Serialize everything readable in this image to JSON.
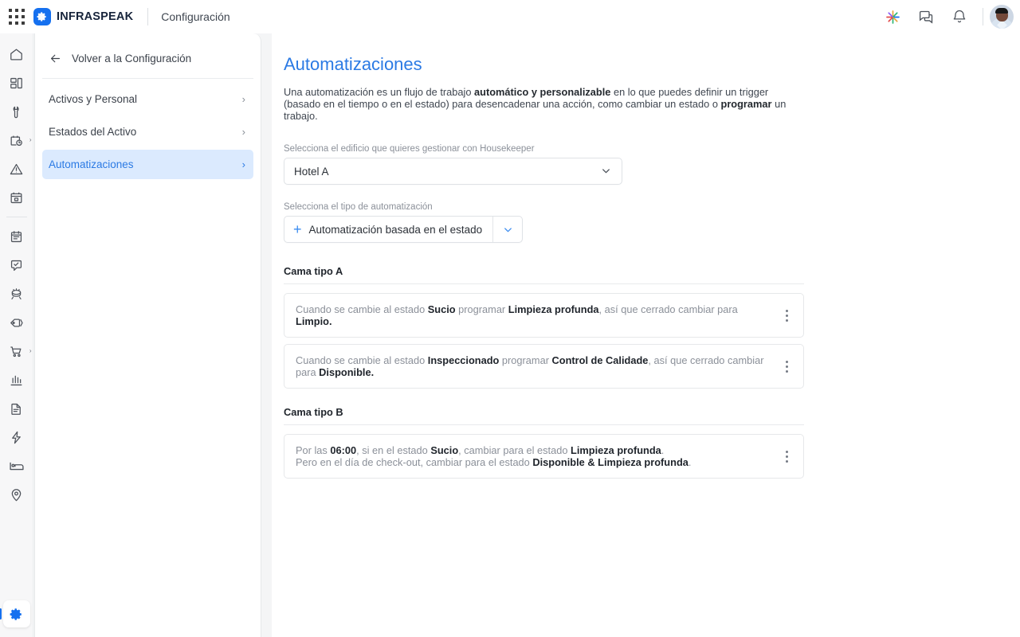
{
  "topbar": {
    "apps_icon": "app-grid-icon",
    "brand_icon": "infraspeak-gear-logo",
    "brand_name": "INFRASPEAK",
    "section_title": "Configuración",
    "right_icons": [
      {
        "name": "ai-sparkle-icon"
      },
      {
        "name": "chat-bubbles-icon"
      },
      {
        "name": "notifications-bell-icon"
      }
    ],
    "avatar": "user-avatar"
  },
  "rail": {
    "items": [
      {
        "name": "home-icon",
        "expandable": false
      },
      {
        "name": "dashboard-icon",
        "expandable": false
      },
      {
        "name": "wrench-icon",
        "expandable": false
      },
      {
        "name": "scheduled-work-icon",
        "expandable": true
      },
      {
        "name": "failures-warning-icon",
        "expandable": false
      },
      {
        "name": "calendar-icon",
        "expandable": false
      },
      {
        "name": "clipboard-icon",
        "expandable": false
      },
      {
        "name": "inspections-chat-icon",
        "expandable": false
      },
      {
        "name": "materials-icon",
        "expandable": false
      },
      {
        "name": "tags-icon",
        "expandable": true
      },
      {
        "name": "purchases-cart-icon",
        "expandable": true
      },
      {
        "name": "analytics-chart-icon",
        "expandable": false
      },
      {
        "name": "documents-icon",
        "expandable": false
      },
      {
        "name": "energy-bolt-icon",
        "expandable": false
      },
      {
        "name": "housekeeping-bed-icon",
        "expandable": false
      },
      {
        "name": "locations-pin-icon",
        "expandable": false
      }
    ],
    "active_item": {
      "name": "settings-gear-icon"
    }
  },
  "settings_panel": {
    "back_label": "Volver a la Configuración",
    "back_icon": "arrow-left-icon",
    "items": [
      {
        "label": "Activos y Personal",
        "active": false
      },
      {
        "label": "Estados del Activo",
        "active": false
      },
      {
        "label": "Automatizaciones",
        "active": true
      }
    ],
    "chevron": "›"
  },
  "main": {
    "title": "Automatizaciones",
    "description": {
      "part1": "Una automatización es un flujo de trabajo ",
      "bold1": "automático y personalizable",
      "part2": " en lo que puedes definir un trigger (basado en el tiempo o en el estado) para desencadenar una acción, como cambiar un estado o ",
      "bold2": "programar",
      "part3": " un trabajo."
    },
    "building_field": {
      "label": "Selecciona el edificio que quieres gestionar con Housekeeper",
      "value": "Hotel A",
      "chevron_icon": "chevron-down-icon"
    },
    "type_field": {
      "label": "Selecciona el tipo de automatización",
      "plus_icon": "plus-icon",
      "value": "Automatización basada en el estado",
      "chevron_icon": "chevron-down-icon"
    },
    "groups": [
      {
        "title": "Cama tipo A",
        "rules": [
          {
            "segments": [
              {
                "t": "Cuando se cambie al estado ",
                "b": false
              },
              {
                "t": "Sucio",
                "b": true
              },
              {
                "t": " programar ",
                "b": false
              },
              {
                "t": "Limpieza profunda",
                "b": true
              },
              {
                "t": ", así que cerrado cambiar para ",
                "b": false
              },
              {
                "t": "Limpio.",
                "b": true
              }
            ],
            "menu_icon": "kebab-menu-icon"
          },
          {
            "segments": [
              {
                "t": "Cuando se cambie al estado ",
                "b": false
              },
              {
                "t": "Inspeccionado",
                "b": true
              },
              {
                "t": " programar ",
                "b": false
              },
              {
                "t": "Control de Calidade",
                "b": true
              },
              {
                "t": ", así que cerrado cambiar para ",
                "b": false
              },
              {
                "t": "Disponible.",
                "b": true
              }
            ],
            "menu_icon": "kebab-menu-icon"
          }
        ]
      },
      {
        "title": "Cama tipo B",
        "rules": [
          {
            "segments": [
              {
                "t": "Por las ",
                "b": false
              },
              {
                "t": "06:00",
                "b": true
              },
              {
                "t": ", si en el estado ",
                "b": false
              },
              {
                "t": "Sucio",
                "b": true
              },
              {
                "t": ", cambiar para el estado ",
                "b": false
              },
              {
                "t": "Limpieza profunda",
                "b": true
              },
              {
                "t": ".",
                "b": false
              },
              {
                "t": "\n",
                "b": false
              },
              {
                "t": " Pero en el día de check-out, cambiar para el estado ",
                "b": false
              },
              {
                "t": "Disponible & Limpieza profunda",
                "b": true
              },
              {
                "t": ".",
                "b": false
              }
            ],
            "menu_icon": "kebab-menu-icon"
          }
        ]
      }
    ]
  },
  "colors": {
    "accent_blue": "#2b7ae4",
    "brand_blue": "#1570ef",
    "active_bg": "#dbeafe",
    "muted_text": "#8b9099",
    "page_bg": "#f4f5f6"
  }
}
